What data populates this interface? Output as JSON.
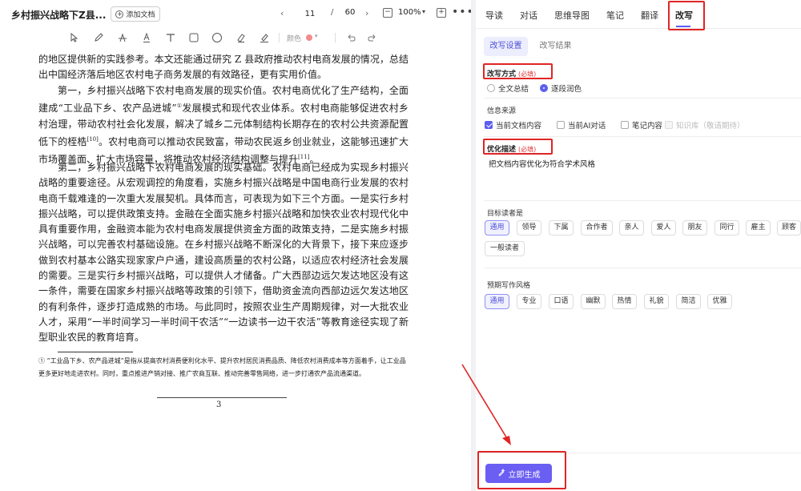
{
  "header": {
    "doc_title": "乡村振兴战略下Z县...",
    "add_doc_label": "添加文档",
    "prev_icon": "chevron-left-icon",
    "current_page": "11",
    "page_sep": "/",
    "total_pages": "60",
    "next_icon": "chevron-right-icon",
    "zoom": "100%",
    "zoom_caret": "▾",
    "zoom_out": "−",
    "zoom_in": "+",
    "more": "•••"
  },
  "toolbar": {
    "tools": [
      "select-icon",
      "pen-icon",
      "strikethrough-icon",
      "underline-icon",
      "text-icon",
      "rectangle-icon",
      "circle-icon",
      "eraser-icon",
      "highlighter-icon"
    ],
    "color_label": "颜色",
    "color_value": "#f28b8b",
    "undo_icon": "undo-icon",
    "redo_icon": "redo-icon"
  },
  "document": {
    "paragraphs": [
      "的地区提供新的实践参考。本文还能通过研究 Z 县政府推动农村电商发展的情况，总结出中国经济落后地区农村电子商务发展的有效路径，更有实用价值。",
      "第一，乡村振兴战略下农村电商发展的现实价值。农村电商优化了生产结构，全面建成“工业品下乡、农产品进城”",
      "第二，乡村振兴战略下农村电商发展的现实基础。农村电商已经成为实现乡村振兴战略的重要途径。从宏观调控的角度看，实施乡村振兴战略是中国电商行业发展的农村电商千载难逢的一次重大发展契机。具体而言，可表现为如下三个方面。一是实行乡村振兴战略，可以提供政策支持。金融在全面实施乡村振兴战略和加快农业农村现代化中具有重要作用，金融资本能为农村电商发展提供资金方面的政策支持，二是实施乡村振兴战略，可以完善农村基础设施。在乡村振兴战略不断深化的大背景下，接下来应逐步做到农村基本公路实现家家户户通，建设高质量的农村公路，以适应农村经济社会发展的需要。三是实行乡村振兴战略，可以提供人才储备。广大西部边远欠发达地区没有这一条件，需要在国家乡村振兴战略等政策的引领下，借助资金流向西部边远欠发达地区的有利条件，逐步打造成熟的市场。与此同时，按照农业生产周期规律，对一大批农业人才，采用“一半时间学习一半时间干农活”“一边读书一边干农活”等教育途径实现了新型职业农民的教育培育。"
    ],
    "para2_sup": "①",
    "para2_rest": "发展模式和现代农业体系。农村电商能够促进农村乡村治理，带动农村社会化发展，解决了城乡二元体制结构长期存在的农村公共资源配置低下的桎梏",
    "para2_cite1": "[10]",
    "para2_mid": "。农村电商可以推动农民致富，带动农民返乡创业就业，这能够迅速扩大市场覆盖面、扩大市场容量，将推动农村经济结构调整与提升",
    "para2_cite2": "[11]",
    "para2_end": "。",
    "footnote": "① “工业品下乡、农产品进城”是指从提高农村消费便利化水平、提升农村居民消费品质、降低农村消费成本等方面着手，让工业品更多更好地走进农村。同时，重点推进产销对接、推广农商互联、推动完善零售网络，进一步打通农产品流通渠道。",
    "page_number": "3"
  },
  "panel": {
    "tabs": [
      {
        "label": "导读"
      },
      {
        "label": "对话"
      },
      {
        "label": "思维导图"
      },
      {
        "label": "笔记"
      },
      {
        "label": "翻译"
      },
      {
        "label": "改写"
      }
    ],
    "active_tab": "改写",
    "subtabs": [
      {
        "label": "改写设置"
      },
      {
        "label": "改写结果"
      }
    ],
    "rewrite_mode": {
      "label": "改写方式",
      "required": "(必填)",
      "options": [
        {
          "label": "全文总结",
          "selected": false
        },
        {
          "label": "逐段润色",
          "selected": true
        }
      ]
    },
    "source": {
      "label": "信息来源",
      "options": [
        {
          "label": "当前文档内容",
          "checked": true
        },
        {
          "label": "当前AI对话",
          "checked": false
        },
        {
          "label": "笔记内容",
          "checked": false
        },
        {
          "label": "知识库（敬请期待）",
          "checked": false,
          "disabled": true
        }
      ]
    },
    "optimize": {
      "label": "优化描述",
      "required": "(必填)",
      "value": "把文档内容优化为符合学术风格"
    },
    "readers": {
      "label": "目标读者是",
      "chips": [
        {
          "label": "通用",
          "selected": true
        },
        {
          "label": "领导",
          "selected": false
        },
        {
          "label": "下属",
          "selected": false
        },
        {
          "label": "合作者",
          "selected": false
        },
        {
          "label": "亲人",
          "selected": false
        },
        {
          "label": "爱人",
          "selected": false
        },
        {
          "label": "朋友",
          "selected": false
        },
        {
          "label": "同行",
          "selected": false
        },
        {
          "label": "雇主",
          "selected": false
        },
        {
          "label": "顾客",
          "selected": false
        },
        {
          "label": "一般读者",
          "selected": false
        }
      ]
    },
    "style": {
      "label": "预期写作风格",
      "chips": [
        {
          "label": "通用",
          "selected": true
        },
        {
          "label": "专业",
          "selected": false
        },
        {
          "label": "口语",
          "selected": false
        },
        {
          "label": "幽默",
          "selected": false
        },
        {
          "label": "热情",
          "selected": false
        },
        {
          "label": "礼貌",
          "selected": false
        },
        {
          "label": "简洁",
          "selected": false
        },
        {
          "label": "优雅",
          "selected": false
        }
      ]
    },
    "generate_label": "立即生成",
    "generate_icon": "magic-pen-icon",
    "accent": "#6b5ef2",
    "annotation_color": "#e02525"
  }
}
